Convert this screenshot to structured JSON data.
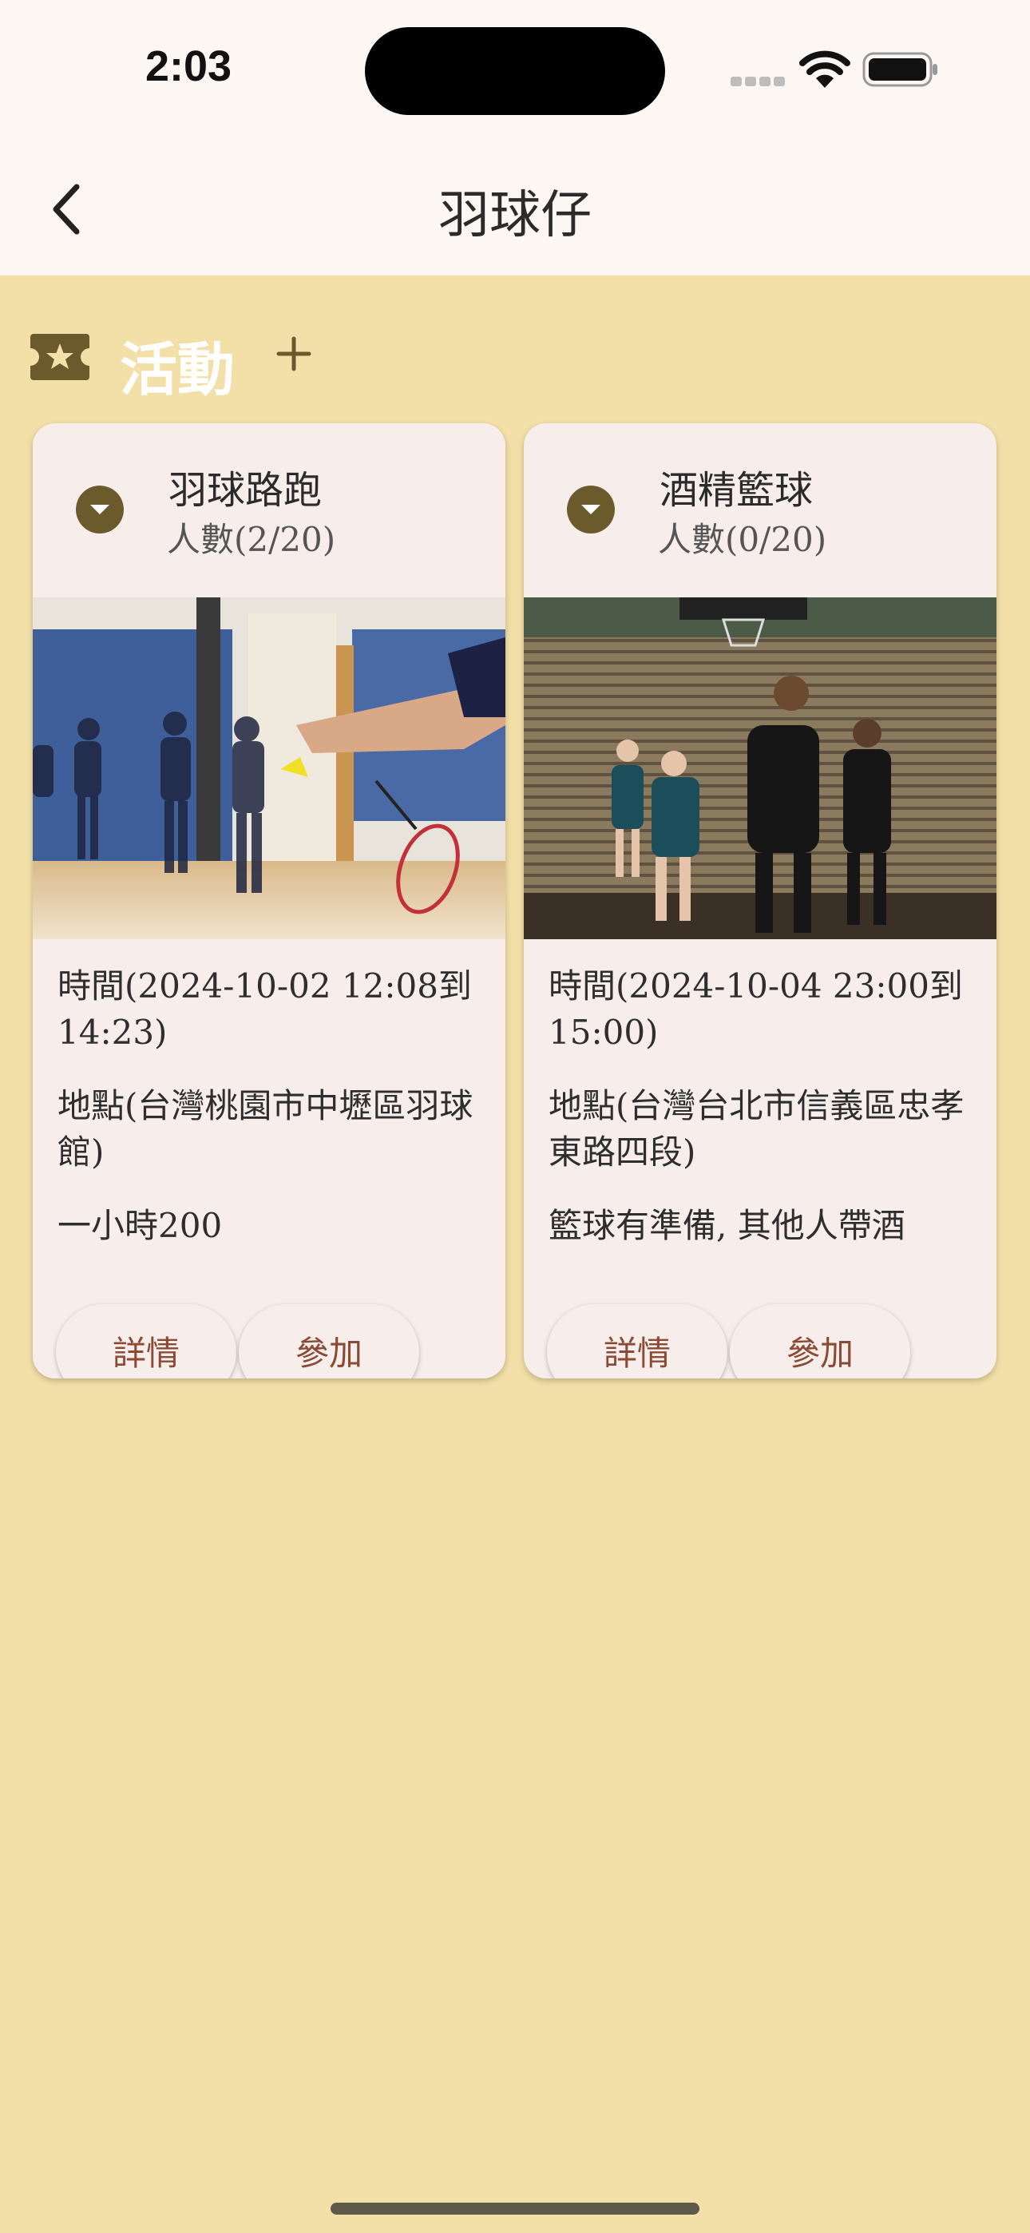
{
  "status_bar": {
    "time": "2:03"
  },
  "app_bar": {
    "title": "羽球仔"
  },
  "section": {
    "title": "活動"
  },
  "cards": [
    {
      "title": "羽球路跑",
      "headcount": "人數(2/20)",
      "time": "時間(2024-10-02 12:08到 14:23)",
      "location": "地點(台灣桃園市中壢區羽球館)",
      "note": "一小時200",
      "detail_label": "詳情",
      "join_label": "參加"
    },
    {
      "title": "酒精籃球",
      "headcount": "人數(0/20)",
      "time": "時間(2024-10-04 23:00到 15:00)",
      "location": "地點(台灣台北市信義區忠孝東路四段)",
      "note": "籃球有準備, 其他人帶酒",
      "detail_label": "詳情",
      "join_label": "參加"
    }
  ],
  "colors": {
    "background": "#f3e0a8",
    "topbar": "#fdf7f4",
    "card": "#f7eeec",
    "accent": "#6b5b2c",
    "button_text": "#8a4a34"
  },
  "icons": [
    "back-arrow-icon",
    "ticket-star-icon",
    "add-icon",
    "dropdown-icon",
    "wifi-icon",
    "battery-icon"
  ]
}
